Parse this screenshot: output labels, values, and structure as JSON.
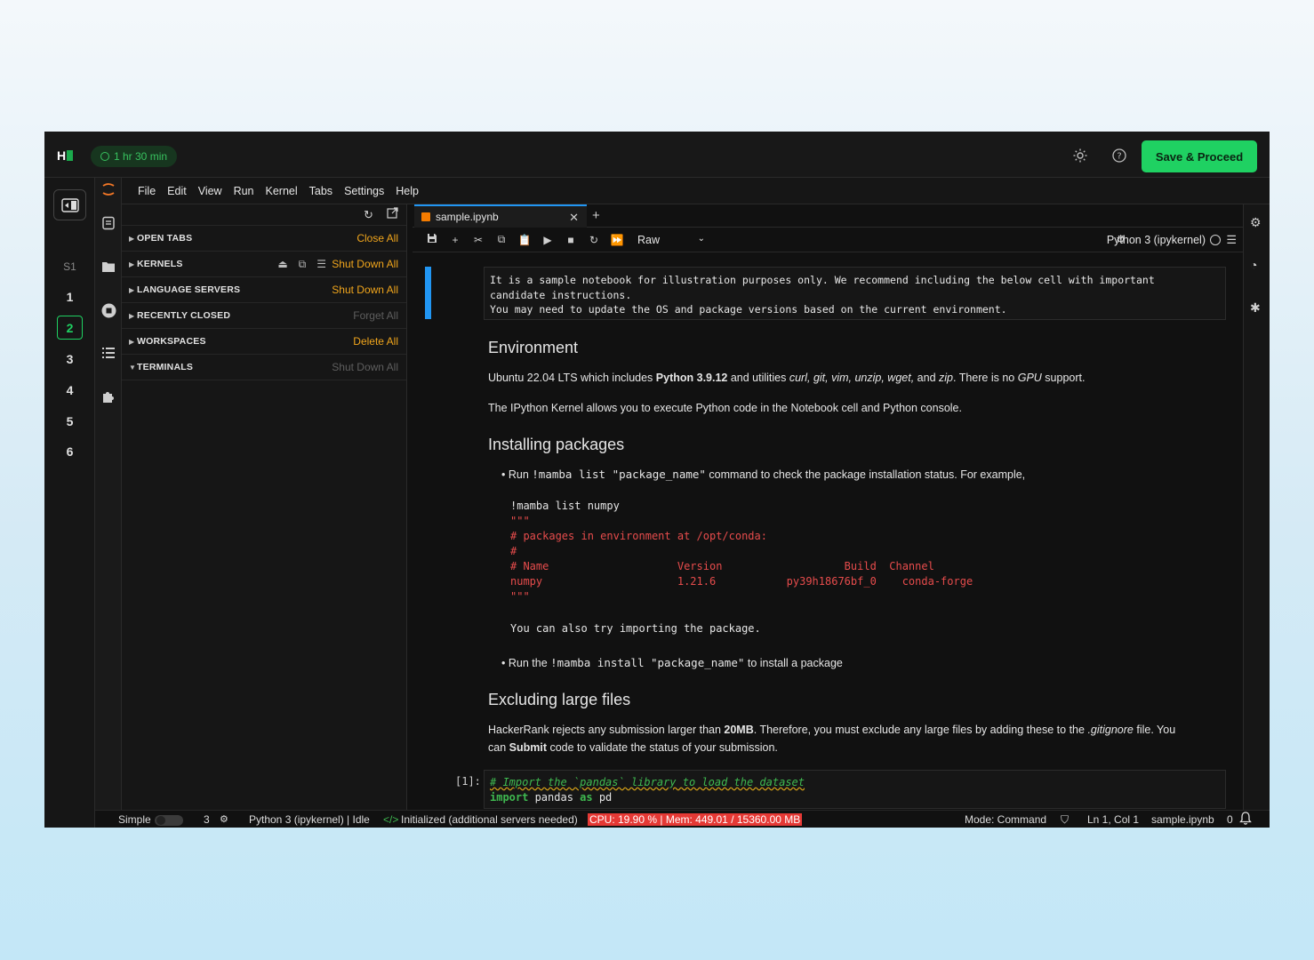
{
  "header": {
    "logo_text": "H",
    "timer": "1 hr 30 min",
    "theme_icon": "sun-icon",
    "help_icon": "help-circle-icon",
    "save_label": "Save & Proceed",
    "accent": "#1fd162"
  },
  "questions": {
    "section": "S1",
    "items": [
      "1",
      "2",
      "3",
      "4",
      "5",
      "6"
    ],
    "active": "2"
  },
  "menu": [
    "File",
    "Edit",
    "View",
    "Run",
    "Kernel",
    "Tabs",
    "Settings",
    "Help"
  ],
  "running_panel": {
    "sections": [
      {
        "title": "OPEN TABS",
        "action": "Close All",
        "expanded": false
      },
      {
        "title": "KERNELS",
        "action": "Shut Down All",
        "expanded": false
      },
      {
        "title": "LANGUAGE SERVERS",
        "action": "Shut Down All",
        "expanded": false
      },
      {
        "title": "RECENTLY CLOSED",
        "action": "Forget All",
        "expanded": false
      },
      {
        "title": "WORKSPACES",
        "action": "Delete All",
        "expanded": false
      },
      {
        "title": "TERMINALS",
        "action": "Shut Down All",
        "expanded": true
      }
    ]
  },
  "notebook": {
    "tab_name": "sample.ipynb",
    "cell_type": "Raw",
    "kernel": "Python 3 (ipykernel)",
    "raw_text": "It is a sample notebook for illustration purposes only. We recommend including the below cell with important\ncandidate instructions.\nYou may need to update the OS and package versions based on the current environment.",
    "env_heading": "Environment",
    "env_p1_a": "Ubuntu 22.04 LTS which includes ",
    "env_p1_b": "Python 3.9.12",
    "env_p1_c": " and utilities ",
    "env_p1_d": "curl, git, vim, unzip, wget,",
    "env_p1_e": " and ",
    "env_p1_f": "zip",
    "env_p1_g": ". There is no ",
    "env_p1_h": "GPU",
    "env_p1_i": " support.",
    "env_p2": "The IPython Kernel allows you to execute Python code in the Notebook cell and Python console.",
    "install_heading": "Installing packages",
    "bullet1_a": "Run ",
    "bullet1_code": "!mamba list \"package_name\"",
    "bullet1_b": " command to check the package installation status. For example,",
    "code_cmd": "!mamba list numpy",
    "code_quote": "\"\"\"",
    "code_comment1": "# packages in environment at /opt/conda:",
    "code_comment2": "#",
    "code_header": "# Name                    Version                   Build  Channel",
    "code_row": "numpy                     1.21.6           py39h18676bf_0    conda-forge",
    "code_quote2": "\"\"\"",
    "code_try": "You can also try importing the package.",
    "bullet2_a": "Run the ",
    "bullet2_code": "!mamba install \"package_name\"",
    "bullet2_b": " to install a package",
    "exclude_heading": "Excluding large files",
    "exclude_p_a": "HackerRank rejects any submission larger than ",
    "exclude_p_b": "20MB",
    "exclude_p_c": ". Therefore, you must exclude any large files by adding these to the ",
    "exclude_p_d": ".gitignore",
    "exclude_p_e": " file. You",
    "exclude_p_f": "can ",
    "exclude_p_g": "Submit",
    "exclude_p_h": " code to validate the status of your submission.",
    "cell_prompt": "[1]:",
    "code_line1": "# Import the `pandas` library to load the dataset",
    "code_line2_kw1": "import",
    "code_line2_mid": " pandas ",
    "code_line2_kw2": "as",
    "code_line2_end": " pd"
  },
  "status_bar": {
    "mode_label": "Simple",
    "count": "3",
    "kernel_status": "Python 3 (ipykernel) | Idle",
    "lsp": "Initialized (additional servers needed)",
    "cpu": "CPU: 19.90 % | Mem: 449.01 / 15360.00 MB",
    "mode": "Mode: Command",
    "cursor": "Ln 1, Col 1",
    "file": "sample.ipynb",
    "notifications": "0"
  }
}
